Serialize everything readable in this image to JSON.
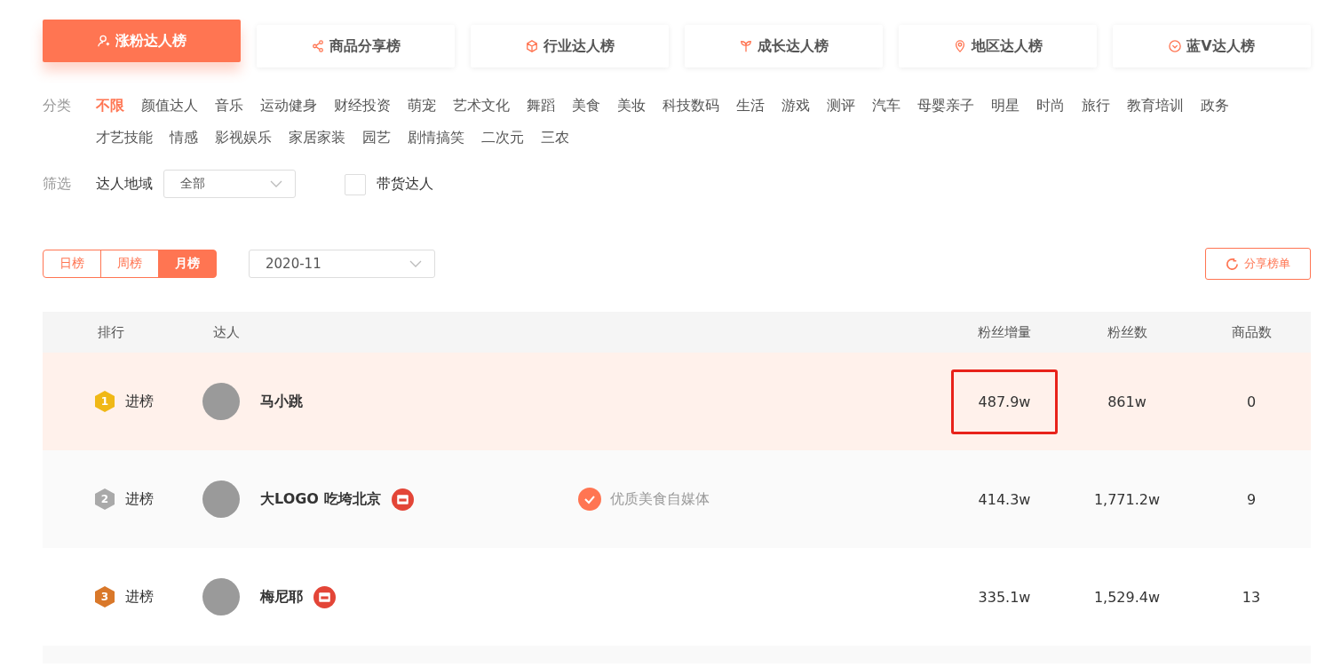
{
  "board_tabs": [
    {
      "label": "涨粉达人榜",
      "kind": "user",
      "selected": true
    },
    {
      "label": "商品分享榜",
      "kind": "share",
      "selected": false
    },
    {
      "label": "行业达人榜",
      "kind": "cube",
      "selected": false
    },
    {
      "label": "成长达人榜",
      "kind": "sprout",
      "selected": false
    },
    {
      "label": "地区达人榜",
      "kind": "pin",
      "selected": false
    },
    {
      "label": "蓝V达人榜",
      "kind": "vcircle",
      "selected": false
    }
  ],
  "category": {
    "label": "分类",
    "items": [
      {
        "label": "不限",
        "selected": true
      },
      {
        "label": "颜值达人",
        "selected": false
      },
      {
        "label": "音乐",
        "selected": false
      },
      {
        "label": "运动健身",
        "selected": false
      },
      {
        "label": "财经投资",
        "selected": false
      },
      {
        "label": "萌宠",
        "selected": false
      },
      {
        "label": "艺术文化",
        "selected": false
      },
      {
        "label": "舞蹈",
        "selected": false
      },
      {
        "label": "美食",
        "selected": false
      },
      {
        "label": "美妆",
        "selected": false
      },
      {
        "label": "科技数码",
        "selected": false
      },
      {
        "label": "生活",
        "selected": false
      },
      {
        "label": "游戏",
        "selected": false
      },
      {
        "label": "测评",
        "selected": false
      },
      {
        "label": "汽车",
        "selected": false
      },
      {
        "label": "母婴亲子",
        "selected": false
      },
      {
        "label": "明星",
        "selected": false
      },
      {
        "label": "时尚",
        "selected": false
      },
      {
        "label": "旅行",
        "selected": false
      },
      {
        "label": "教育培训",
        "selected": false
      },
      {
        "label": "政务",
        "selected": false
      },
      {
        "label": "才艺技能",
        "selected": false
      },
      {
        "label": "情感",
        "selected": false
      },
      {
        "label": "影视娱乐",
        "selected": false
      },
      {
        "label": "家居家装",
        "selected": false
      },
      {
        "label": "园艺",
        "selected": false
      },
      {
        "label": "剧情搞笑",
        "selected": false
      },
      {
        "label": "二次元",
        "selected": false
      },
      {
        "label": "三农",
        "selected": false
      }
    ]
  },
  "filter": {
    "label": "筛选",
    "region_label": "达人地域",
    "region_value": "全部",
    "goods_label": "带货达人",
    "goods_checked": false
  },
  "periods": [
    {
      "label": "日榜",
      "selected": false
    },
    {
      "label": "周榜",
      "selected": false
    },
    {
      "label": "月榜",
      "selected": true
    }
  ],
  "date_select": "2020-11",
  "share_button": "分享榜单",
  "table": {
    "columns": [
      "排行",
      "达人",
      "粉丝增量",
      "粉丝数",
      "商品数"
    ],
    "rows": [
      {
        "rank": "1",
        "color": "#f0b816",
        "status": "进榜",
        "name": "马小跳",
        "shop": false,
        "increase": "487.9w",
        "fans": "861w",
        "products": "0",
        "hovered": true,
        "highlighted": true
      },
      {
        "rank": "2",
        "color": "#a9a9a9",
        "status": "进榜",
        "name": "大LOGO 吃垮北京",
        "shop": true,
        "tag": "优质美食自媒体",
        "increase": "414.3w",
        "fans": "1,771.2w",
        "products": "9",
        "hovered": false,
        "highlighted": false
      },
      {
        "rank": "3",
        "color": "#d9782a",
        "status": "进榜",
        "name": "梅尼耶",
        "shop": true,
        "increase": "335.1w",
        "fans": "1,529.4w",
        "products": "13",
        "hovered": false,
        "highlighted": false
      }
    ]
  }
}
